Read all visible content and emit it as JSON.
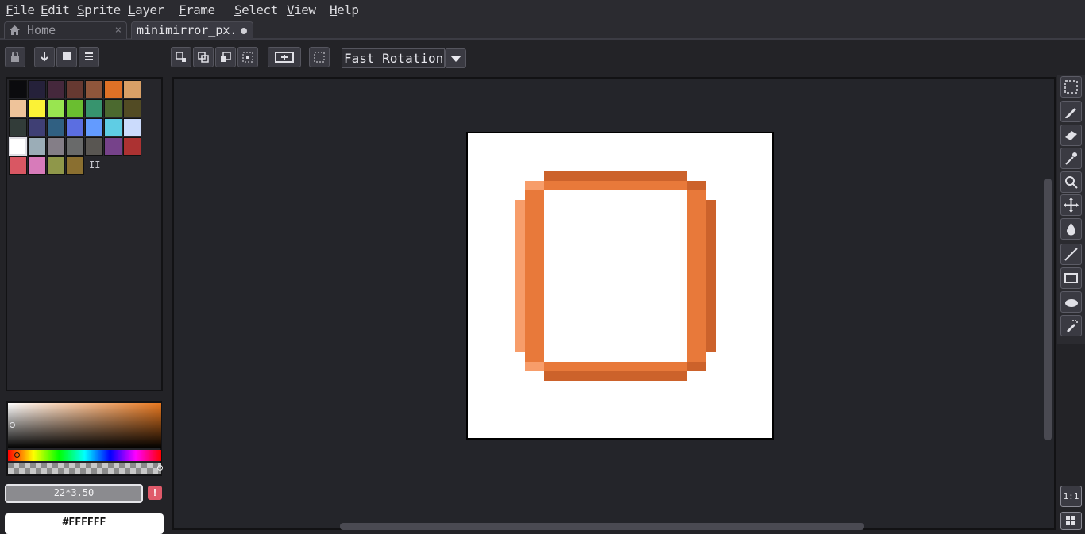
{
  "menu": [
    "File",
    "Edit",
    "Sprite",
    "Layer",
    "Frame",
    "Select",
    "View",
    "Help"
  ],
  "tabs": {
    "home": {
      "label": "Home",
      "close": "×",
      "icon": "home-icon"
    },
    "file": {
      "label": "minimirror_px.",
      "modified_icon": "unsaved-dot-icon"
    }
  },
  "toolbar": {
    "rotation_mode": "Fast Rotation",
    "buttons": [
      "lock-icon",
      "download-icon",
      "stop-icon",
      "menu-icon",
      "duplicate-icon",
      "copy-icon",
      "transform-icon",
      "select-pixels-icon",
      "fit-screen-icon",
      "marquee-icon",
      "dropdown-arrow-icon"
    ]
  },
  "palette": {
    "colors": [
      "#0b0b0e",
      "#25213a",
      "#45283c",
      "#663931",
      "#8f563b",
      "#df7126",
      "#d9a066",
      "#eec39a",
      "#fbf236",
      "#99e550",
      "#6abe30",
      "#37946e",
      "#4b692f",
      "#524b24",
      "#323c39",
      "#3f3f74",
      "#306082",
      "#5b6ee1",
      "#639bff",
      "#5fcde4",
      "#cbdbfc",
      "#ffffff",
      "#9badb7",
      "#847e87",
      "#696a6a",
      "#595652",
      "#76428a",
      "#ac3232",
      "#d95763",
      "#d77bba",
      "#8f974a",
      "#8a6f30"
    ],
    "more_label": "II"
  },
  "color": {
    "value_label": "22*3.50",
    "warning": "!",
    "hex": "#FFFFFF",
    "base_hue": "#e8781f"
  },
  "sprite": {
    "outline_colors": {
      "main": "#e8793a",
      "dark": "#cc622b",
      "light": "#f79d6a"
    }
  },
  "tools": [
    "rectangular-marquee-icon",
    "pencil-icon",
    "eraser-icon",
    "eyedropper-icon",
    "zoom-icon",
    "move-icon",
    "paint-bucket-icon",
    "line-icon",
    "rectangle-icon",
    "blur-icon",
    "spray-icon"
  ],
  "view": {
    "ratio_label": "1:1"
  }
}
